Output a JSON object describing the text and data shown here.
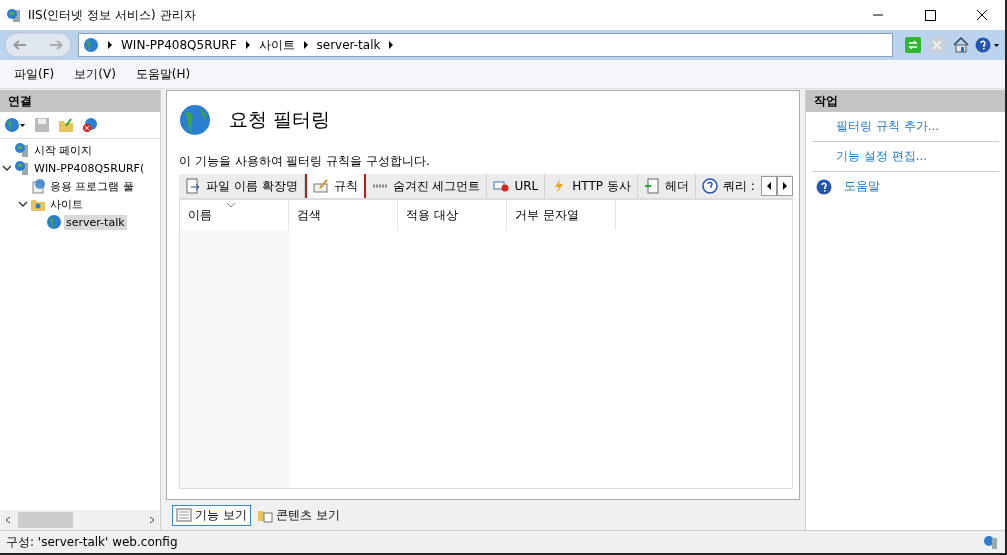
{
  "window": {
    "title": "IIS(인터넷 정보 서비스) 관리자"
  },
  "address": {
    "crumbs": [
      "WIN-PP408Q5RURF",
      "사이트",
      "server-talk"
    ]
  },
  "menu": [
    "파일(F)",
    "보기(V)",
    "도움말(H)"
  ],
  "connections": {
    "title": "연결",
    "tree": [
      {
        "label": "시작 페이지",
        "selected": false
      },
      {
        "label": "WIN-PP408Q5RURF(",
        "selected": false,
        "expanded": true,
        "children": [
          {
            "label": "응용 프로그램 풀",
            "selected": false
          },
          {
            "label": "사이트",
            "selected": false,
            "expanded": true,
            "children": [
              {
                "label": "server-talk",
                "selected": true
              }
            ]
          }
        ]
      }
    ]
  },
  "feature": {
    "title": "요청 필터링",
    "description": "이 기능을 사용하여 필터링 규칙을 구성합니다.",
    "tabs": [
      {
        "label": "파일 이름 확장명",
        "selected": false
      },
      {
        "label": "규칙",
        "selected": true
      },
      {
        "label": "숨겨진 세그먼트",
        "selected": false
      },
      {
        "label": "URL",
        "selected": false
      },
      {
        "label": "HTTP 동사",
        "selected": false
      },
      {
        "label": "헤더",
        "selected": false
      },
      {
        "label": "쿼리 :",
        "selected": false
      }
    ],
    "table": {
      "columns": [
        "이름",
        "검색",
        "적용 대상",
        "거부 문자열"
      ]
    }
  },
  "views": [
    {
      "label": "기능 보기",
      "selected": true
    },
    {
      "label": "콘텐츠 보기",
      "selected": false
    }
  ],
  "actions": {
    "title": "작업",
    "items": [
      {
        "label": "필터링 규칙 추가...",
        "kind": "link"
      },
      {
        "label": "기능 설정 편집...",
        "kind": "link"
      },
      {
        "label": "도움말",
        "kind": "help"
      }
    ]
  },
  "status_bar": "구성: 'server-talk' web.config"
}
